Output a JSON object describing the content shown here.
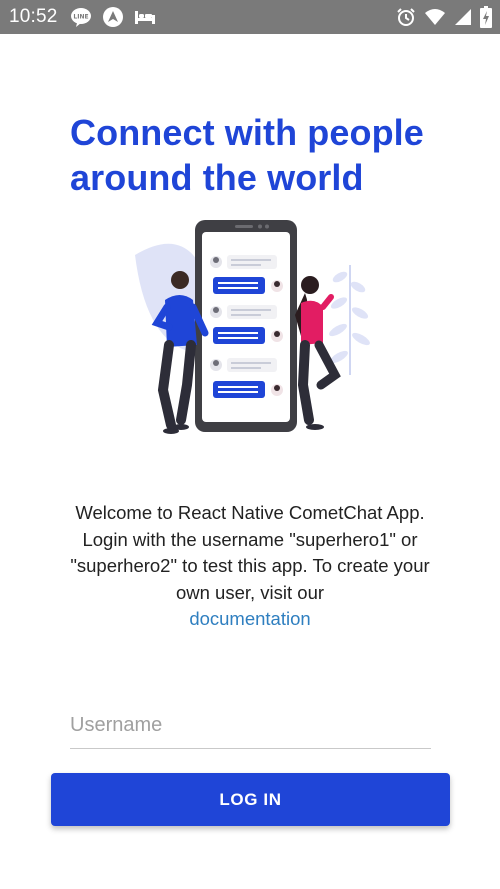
{
  "status_bar": {
    "time": "10:52",
    "left_icons": [
      "line-icon",
      "arrow-nav-icon",
      "bed-icon"
    ],
    "right_icons": [
      "alarm-icon",
      "wifi-icon",
      "signal-icon",
      "battery-icon"
    ]
  },
  "heading": {
    "line1": "Connect with people",
    "line2": "around the world"
  },
  "welcome": {
    "text": "Welcome to React Native CometChat App. Login with the username \"superhero1\" or \"superhero2\" to test this app. To create your own user, visit our",
    "link_label": "documentation"
  },
  "login_form": {
    "username_placeholder": "Username",
    "username_value": "",
    "button_label": "LOG IN"
  },
  "colors": {
    "brand": "#1f45d7",
    "link": "#2f7fc0",
    "status_bar": "#7a7a7a"
  }
}
